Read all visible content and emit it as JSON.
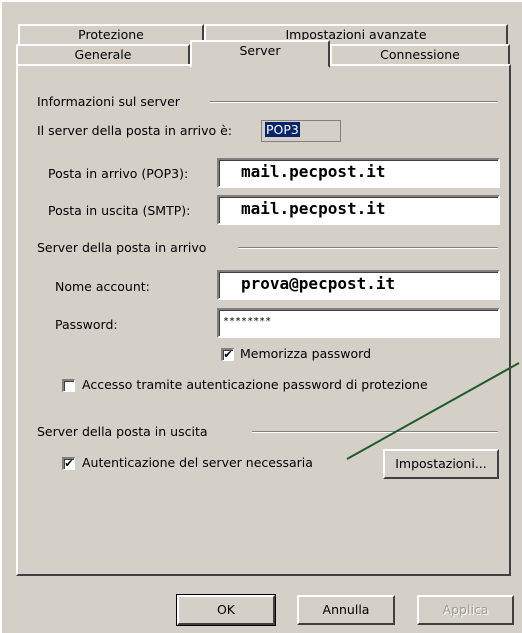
{
  "tabs": {
    "row1": [
      "Protezione",
      "Impostazioni avanzate"
    ],
    "row2": [
      "Generale",
      "Server",
      "Connessione"
    ],
    "active": "Server"
  },
  "server_info": {
    "group_label": "Informazioni sul server",
    "incoming_type_label": "Il server della posta in arrivo è:",
    "incoming_type_value": "POP3",
    "incoming_label": "Posta in arrivo (POP3):",
    "incoming_value": "mail.pecpost.it",
    "outgoing_label": "Posta in uscita (SMTP):",
    "outgoing_value": "mail.pecpost.it"
  },
  "incoming_server": {
    "group_label": "Server della posta in arrivo",
    "account_label": "Nome account:",
    "account_value": "prova@pecpost.it",
    "password_label": "Password:",
    "password_value": "********",
    "remember_label": "Memorizza password",
    "remember_checked": true,
    "spa_label": "Accesso tramite autenticazione password di protezione",
    "spa_checked": false
  },
  "outgoing_server": {
    "group_label": "Server della posta in uscita",
    "auth_label": "Autenticazione del server necessaria",
    "auth_checked": true,
    "settings_button": "Impostazioni..."
  },
  "buttons": {
    "ok": "OK",
    "cancel": "Annulla",
    "apply": "Applica"
  },
  "annotation": {
    "color": "#1f5a2a"
  }
}
